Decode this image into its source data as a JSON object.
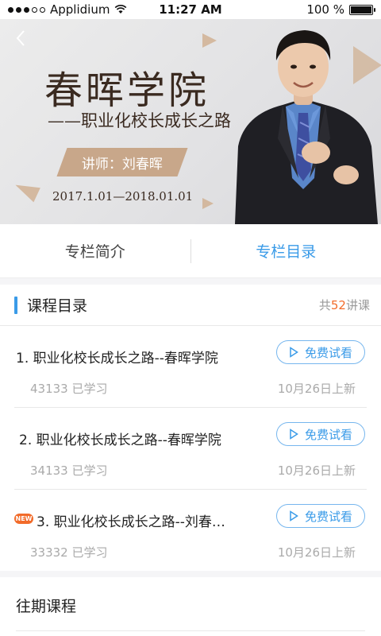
{
  "status_bar": {
    "carrier": "Applidium",
    "time": "11:27 AM",
    "battery": "100 %",
    "battery_level": 1.0
  },
  "banner": {
    "title": "春晖学院",
    "subtitle": "——职业化校长成长之路",
    "lecturer": "讲师：刘春晖",
    "date_range": "2017.1.01—2018.01.01",
    "accent_color": "#c8a78a"
  },
  "tabs": [
    {
      "label": "专栏简介",
      "active": false
    },
    {
      "label": "专栏目录",
      "active": true
    }
  ],
  "course_list": {
    "title": "课程目录",
    "count_prefix": "共",
    "count": "52",
    "count_suffix": "讲课",
    "lessons": [
      {
        "title": "1. 职业化校长成长之路--春晖学院",
        "learners": "43133 已学习",
        "update": "10月26日上新",
        "button": "免费试看",
        "is_new": false
      },
      {
        "title": "2. 职业化校长成长之路--春晖学院",
        "learners": "34133 已学习",
        "update": "10月26日上新",
        "button": "免费试看",
        "is_new": false
      },
      {
        "title": "3. 职业化校长成长之路--刘春…",
        "learners": "33332 已学习",
        "update": "10月26日上新",
        "button": "免费试看",
        "is_new": true,
        "badge": "NEW"
      }
    ]
  },
  "past_courses": {
    "title": "往期课程"
  },
  "colors": {
    "accent_blue": "#3a9be8",
    "accent_orange": "#f26b2a"
  },
  "icons": {
    "back": "chevron-left-icon",
    "wifi": "wifi-icon",
    "battery": "battery-icon",
    "play": "play-icon"
  }
}
